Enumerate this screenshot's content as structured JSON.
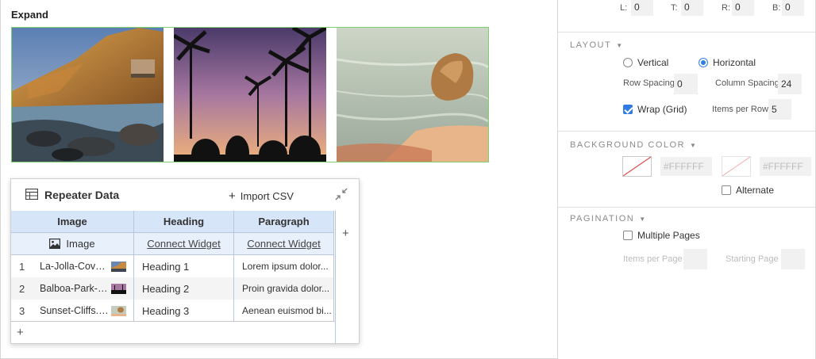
{
  "canvas": {
    "title": "Expand"
  },
  "data_panel": {
    "title": "Repeater Data",
    "import_label": "Import CSV",
    "columns": [
      "Image",
      "Heading",
      "Paragraph"
    ],
    "bindings": {
      "image_label": "Image",
      "heading_link": "Connect Widget",
      "paragraph_link": "Connect Widget"
    },
    "rows": [
      {
        "num": "1",
        "image": "La-Jolla-Cove.jpg",
        "heading": "Heading 1",
        "paragraph": "Lorem ipsum dolor..."
      },
      {
        "num": "2",
        "image": "Balboa-Park-su...",
        "heading": "Heading 2",
        "paragraph": "Proin gravida dolor..."
      },
      {
        "num": "3",
        "image": "Sunset-Cliffs.jpg",
        "heading": "Heading 3",
        "paragraph": "Aenean euismod bi..."
      }
    ],
    "add_col_label": "+",
    "add_row_label": "+"
  },
  "props": {
    "padding": {
      "l_label": "L:",
      "l": "0",
      "t_label": "T:",
      "t": "0",
      "r_label": "R:",
      "r": "0",
      "b_label": "B:",
      "b": "0"
    },
    "layout": {
      "title": "LAYOUT",
      "vertical": "Vertical",
      "horizontal": "Horizontal",
      "selected": "Horizontal",
      "row_spacing_label": "Row Spacing",
      "row_spacing": "0",
      "column_spacing_label": "Column Spacing",
      "column_spacing": "24",
      "wrap_label": "Wrap (Grid)",
      "wrap_checked": true,
      "items_per_row_label": "Items per Row",
      "items_per_row": "5"
    },
    "background": {
      "title": "BACKGROUND COLOR",
      "color1": "#FFFFFF",
      "color2": "#FFFFFF",
      "alternate_label": "Alternate",
      "alternate_checked": false
    },
    "pagination": {
      "title": "PAGINATION",
      "multiple_pages_label": "Multiple Pages",
      "multiple_pages_checked": false,
      "items_per_page_label": "Items per Page",
      "starting_page_label": "Starting Page"
    }
  },
  "colors": {
    "accent": "#2f7de1",
    "selection_border": "#7fcf6e",
    "header_fill": "#d6e5f8",
    "binding_fill": "#e8f0fb"
  }
}
